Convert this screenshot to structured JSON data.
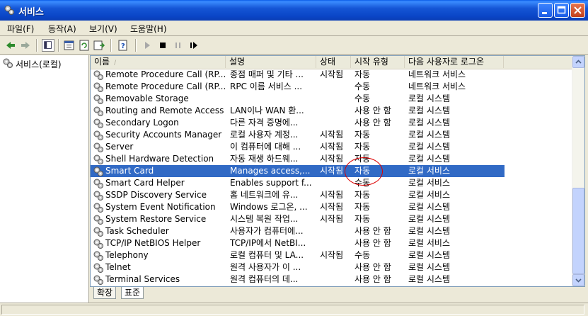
{
  "window": {
    "title": "서비스",
    "controls": [
      "minimize",
      "maximize",
      "close"
    ]
  },
  "menu": [
    "파일(F)",
    "동작(A)",
    "보기(V)",
    "도움말(H)"
  ],
  "toolbar": {
    "icons": [
      "back-icon",
      "forward-icon",
      "show-console-tree-icon",
      "properties-icon",
      "refresh-icon",
      "export-list-icon",
      "help-icon",
      "start-service-icon",
      "stop-service-icon",
      "pause-service-icon",
      "restart-service-icon"
    ]
  },
  "tree": {
    "root": "서비스(로컬)"
  },
  "list": {
    "columns": [
      "이름",
      "설명",
      "상태",
      "시작 유형",
      "다음 사용자로 로그온"
    ],
    "sort_indicator": "/",
    "rows": [
      {
        "name": "Remote Procedure Call (RP...",
        "desc": "종점 매퍼 및 기타 ...",
        "status": "시작됨",
        "startup": "자동",
        "logon": "네트워크 서비스",
        "selected": false
      },
      {
        "name": "Remote Procedure Call (RP...",
        "desc": "RPC 이름 서비스 ...",
        "status": "",
        "startup": "수동",
        "logon": "네트워크 서비스",
        "selected": false
      },
      {
        "name": "Removable Storage",
        "desc": "",
        "status": "",
        "startup": "수동",
        "logon": "로컬 시스템",
        "selected": false
      },
      {
        "name": "Routing and Remote Access",
        "desc": "LAN이나 WAN 환...",
        "status": "",
        "startup": "사용 안 함",
        "logon": "로컬 시스템",
        "selected": false
      },
      {
        "name": "Secondary Logon",
        "desc": "다른 자격 증명에...",
        "status": "",
        "startup": "사용 안 함",
        "logon": "로컬 시스템",
        "selected": false
      },
      {
        "name": "Security Accounts Manager",
        "desc": "로컬 사용자 계정...",
        "status": "시작됨",
        "startup": "자동",
        "logon": "로컬 시스템",
        "selected": false
      },
      {
        "name": "Server",
        "desc": "이 컴퓨터에 대해 ...",
        "status": "시작됨",
        "startup": "자동",
        "logon": "로컬 시스템",
        "selected": false
      },
      {
        "name": "Shell Hardware Detection",
        "desc": "자동 재생 하드웨...",
        "status": "시작됨",
        "startup": "자동",
        "logon": "로컬 시스템",
        "selected": false
      },
      {
        "name": "Smart Card",
        "desc": "Manages access,...",
        "status": "시작됨",
        "startup": "자동",
        "logon": "로컬 서비스",
        "selected": true
      },
      {
        "name": "Smart Card Helper",
        "desc": "Enables support f...",
        "status": "",
        "startup": "수동",
        "logon": "로컬 서비스",
        "selected": false
      },
      {
        "name": "SSDP Discovery Service",
        "desc": "홈 네트워크에 유...",
        "status": "시작됨",
        "startup": "자동",
        "logon": "로컬 서비스",
        "selected": false
      },
      {
        "name": "System Event Notification",
        "desc": "Windows 로그온, ...",
        "status": "시작됨",
        "startup": "자동",
        "logon": "로컬 시스템",
        "selected": false
      },
      {
        "name": "System Restore Service",
        "desc": "시스템 복원 작업...",
        "status": "시작됨",
        "startup": "자동",
        "logon": "로컬 시스템",
        "selected": false
      },
      {
        "name": "Task Scheduler",
        "desc": "사용자가 컴퓨터에...",
        "status": "",
        "startup": "사용 안 함",
        "logon": "로컬 시스템",
        "selected": false
      },
      {
        "name": "TCP/IP NetBIOS Helper",
        "desc": "TCP/IP에서 NetBI...",
        "status": "",
        "startup": "사용 안 함",
        "logon": "로컬 서비스",
        "selected": false
      },
      {
        "name": "Telephony",
        "desc": "로컬 컴퓨터 및 LA...",
        "status": "시작됨",
        "startup": "수동",
        "logon": "로컬 시스템",
        "selected": false
      },
      {
        "name": "Telnet",
        "desc": "원격 사용자가 이 ...",
        "status": "",
        "startup": "사용 안 함",
        "logon": "로컬 시스템",
        "selected": false
      },
      {
        "name": "Terminal Services",
        "desc": "원격 컴퓨터의 데...",
        "status": "",
        "startup": "사용 안 함",
        "logon": "로컬 시스템",
        "selected": false
      }
    ]
  },
  "tabs": [
    "확장",
    "표준"
  ],
  "active_tab": "표준",
  "colors": {
    "titlebar": "#0a45c6",
    "selection": "#316ac5",
    "annotation": "#dd0000"
  }
}
